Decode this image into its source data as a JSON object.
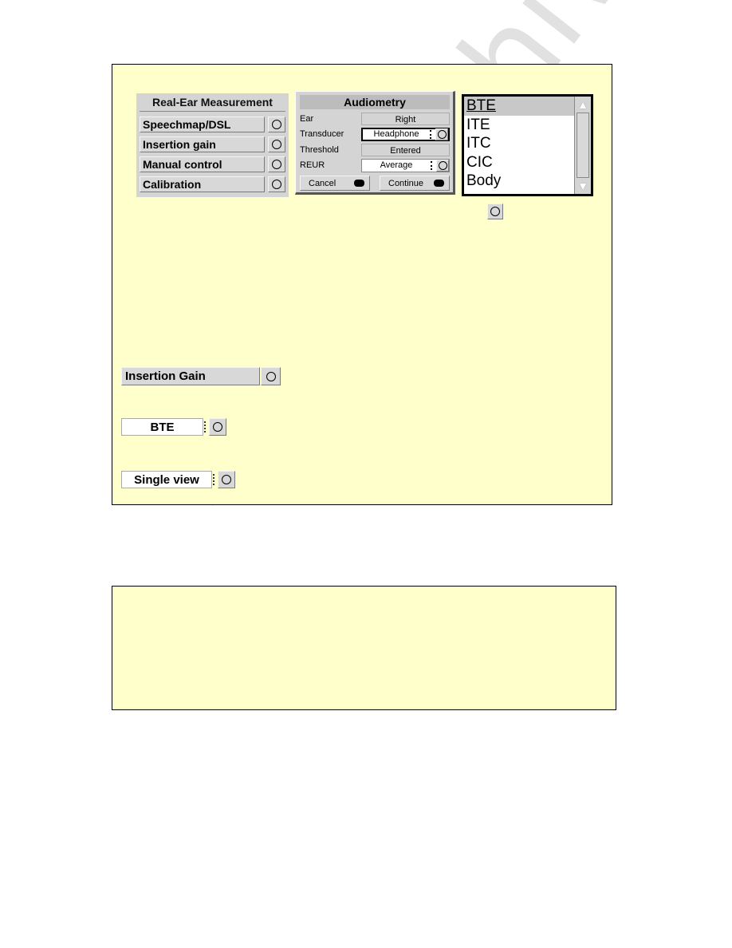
{
  "rem_menu": {
    "title": "Real-Ear Measurement",
    "items": [
      {
        "label": "Speechmap/DSL"
      },
      {
        "label": "Insertion gain"
      },
      {
        "label": "Manual control"
      },
      {
        "label": "Calibration"
      }
    ]
  },
  "audiometry": {
    "title": "Audiometry",
    "rows": [
      {
        "label": "Ear",
        "value": "Right"
      },
      {
        "label": "Transducer",
        "value": "Headphone"
      },
      {
        "label": "Threshold",
        "value": "Entered"
      },
      {
        "label": "REUR",
        "value": "Average"
      }
    ],
    "cancel_label": "Cancel",
    "continue_label": "Continue"
  },
  "listbox": {
    "items": [
      "BTE",
      "ITE",
      "ITC",
      "CIC",
      "Body"
    ],
    "selected": "BTE"
  },
  "controls": {
    "insertion_gain_label": "Insertion Gain",
    "instrument_value": "BTE",
    "view_value": "Single view"
  },
  "icons": {
    "action": "circle-icon",
    "scroll_up": "▲",
    "scroll_down": "▼"
  },
  "watermark": "manualshive.com",
  "colors": {
    "panel_bg": "#ffffcc",
    "widget_bg": "#d4d4d4"
  }
}
